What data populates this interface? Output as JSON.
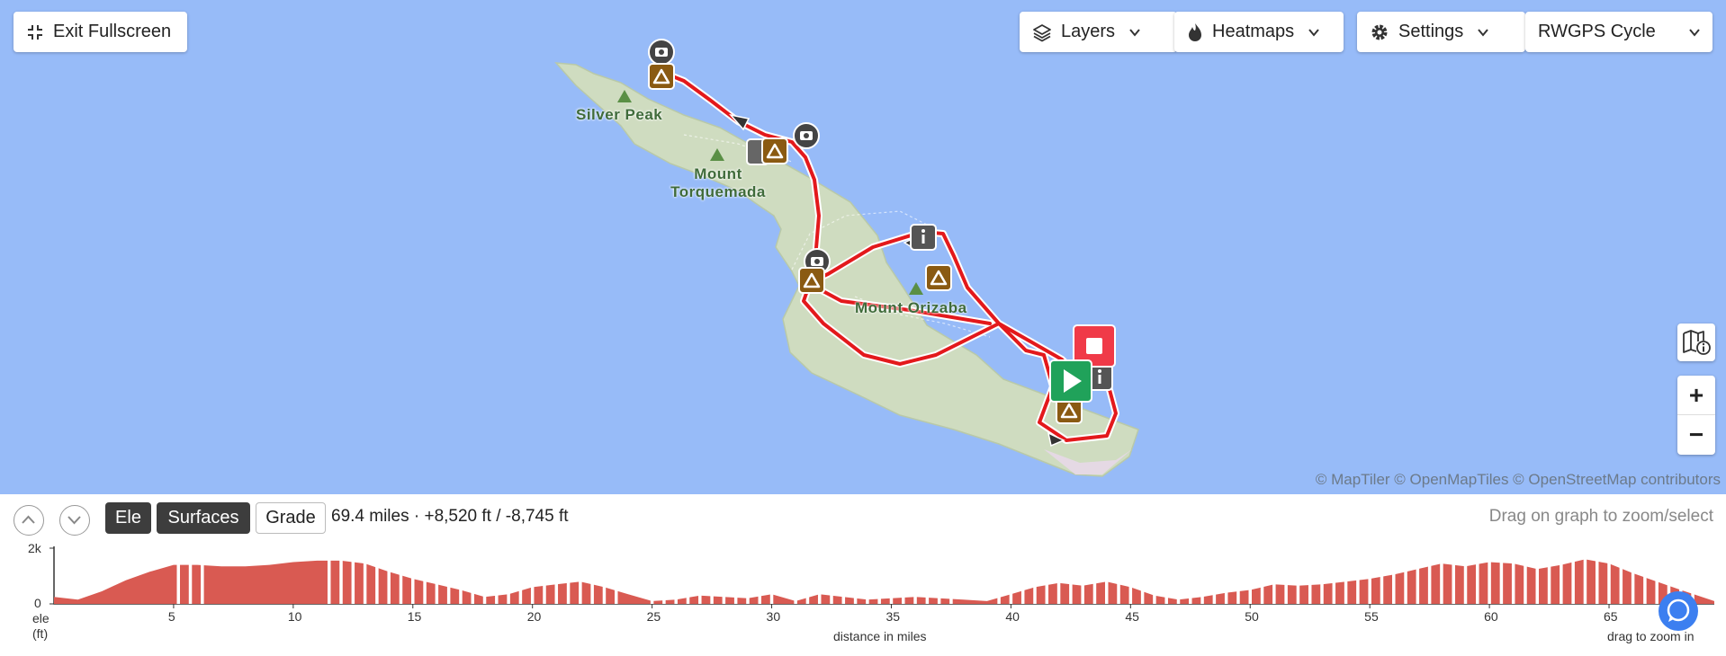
{
  "controls": {
    "exit_fullscreen": "Exit Fullscreen",
    "layers": "Layers",
    "heatmaps": "Heatmaps",
    "settings": "Settings",
    "map_style": "RWGPS Cycle"
  },
  "map": {
    "water_color": "#97bbf8",
    "land_color": "#cfdcc0",
    "route_color": "#e3191c",
    "peaks": [
      {
        "name": "Silver Peak",
        "lines": [
          "Silver Peak"
        ]
      },
      {
        "name": "Mount Torquemada",
        "lines": [
          "Mount",
          "Torquemada"
        ]
      },
      {
        "name": "Mount Orizaba",
        "lines": [
          "Mount Orizaba"
        ]
      }
    ],
    "markers": [
      "camera-icon",
      "campsite-icon",
      "info-icon",
      "start-icon",
      "stop-icon"
    ],
    "attribution": "© MapTiler © OpenMapTiles © OpenStreetMap contributors",
    "zoom_in": "+",
    "zoom_out": "−"
  },
  "elevation_panel": {
    "tabs": [
      "Ele",
      "Surfaces",
      "Grade"
    ],
    "summary": "69.4 miles · +8,520 ft / -8,745 ft",
    "hint": "Drag on graph to zoom/select",
    "ylabel_line1": "ele",
    "ylabel_line2": "(ft)",
    "y_ticks": [
      "2k",
      "0"
    ],
    "xlabel": "distance in miles",
    "x_ticks": [
      "5",
      "10",
      "15",
      "20",
      "25",
      "30",
      "35",
      "40",
      "45",
      "50",
      "55",
      "60",
      "65"
    ],
    "footer_hint": "drag to zoom in",
    "profile_color": "#d95a52"
  },
  "chart_data": {
    "type": "area",
    "xlabel": "distance in miles",
    "ylabel": "ele (ft)",
    "xlim": [
      0,
      69.4
    ],
    "ylim": [
      0,
      2000
    ],
    "x": [
      0,
      1,
      2,
      3,
      4,
      5,
      6,
      7,
      8,
      9,
      10,
      11,
      12,
      13,
      14,
      15,
      16,
      17,
      18,
      19,
      20,
      21,
      22,
      23,
      24,
      25,
      26,
      27,
      28,
      29,
      30,
      31,
      32,
      33,
      34,
      35,
      36,
      37,
      38,
      39,
      40,
      41,
      42,
      43,
      44,
      45,
      46,
      47,
      48,
      49,
      50,
      51,
      52,
      53,
      54,
      55,
      56,
      57,
      58,
      59,
      60,
      61,
      62,
      63,
      64,
      65,
      66,
      67,
      68,
      69.4
    ],
    "y": [
      250,
      150,
      450,
      850,
      1150,
      1400,
      1400,
      1350,
      1350,
      1400,
      1500,
      1550,
      1550,
      1450,
      1150,
      900,
      700,
      500,
      250,
      350,
      600,
      700,
      800,
      600,
      350,
      100,
      150,
      300,
      250,
      200,
      350,
      100,
      350,
      250,
      150,
      200,
      250,
      200,
      150,
      100,
      350,
      600,
      750,
      650,
      800,
      600,
      300,
      150,
      250,
      400,
      500,
      700,
      650,
      700,
      800,
      900,
      1050,
      1250,
      1450,
      1350,
      1500,
      1450,
      1250,
      1400,
      1600,
      1450,
      1100,
      800,
      500,
      100
    ]
  }
}
